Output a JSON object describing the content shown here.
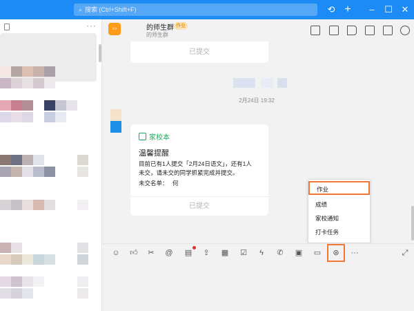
{
  "search": {
    "placeholder": "搜索 (Ctrl+Shift+F)"
  },
  "window_controls": [
    "history-icon",
    "plus-icon",
    "minimize-icon",
    "maximize-icon",
    "close-icon"
  ],
  "chat": {
    "group_name": "的师生群",
    "group_tag": "作业",
    "group_sub": "的师生群",
    "header_icons": [
      "video-icon",
      "check-icon",
      "announce-icon",
      "folder-icon",
      "search-doc-icon",
      "gear-icon"
    ]
  },
  "messages": {
    "earlier_card_footer": "已提交",
    "timestamp": "2月24日 19:32",
    "card": {
      "app_name": "家校本",
      "title": "温馨提醒",
      "body": "目前已有1人提交「2月24日语文」，还有1人未交，请未交的同学抓紧完成并提交。",
      "missing_label": "未交名单：",
      "missing_value": "何",
      "footer": "已提交"
    }
  },
  "popup_menu": {
    "items": [
      "作业",
      "成绩",
      "家校通知",
      "打卡任务"
    ],
    "selected": "作业"
  },
  "toolbar_icons": [
    "emoji-icon",
    "thumbs-up-icon",
    "scissors-icon",
    "at-icon",
    "doc-icon",
    "upload-icon",
    "calendar-icon",
    "task-icon",
    "lightning-icon",
    "call-icon",
    "live-icon",
    "screen-icon",
    "homework-icon",
    "more-icon",
    "expand-icon"
  ],
  "colors": {
    "accent": "#1d8bf5",
    "highlight": "#f07832",
    "app_green": "#1fa85a"
  }
}
